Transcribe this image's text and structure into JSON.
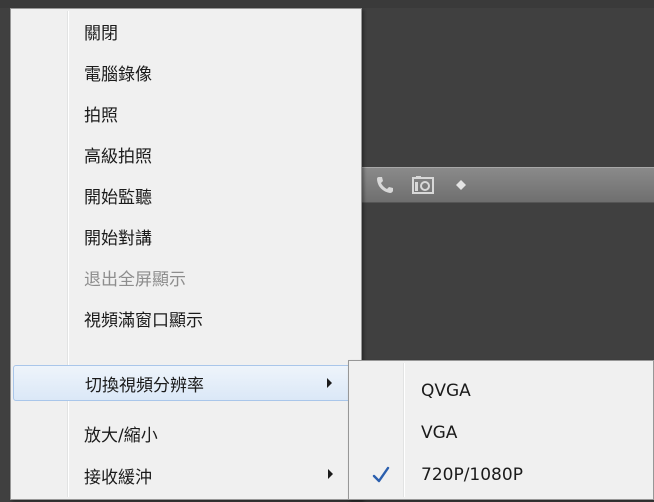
{
  "video": {
    "toolbar_icons": [
      "phone-icon",
      "camera-icon",
      "dot-icon"
    ]
  },
  "menu": {
    "items": [
      {
        "label": "關閉",
        "enabled": true
      },
      {
        "label": "電腦錄像",
        "enabled": true
      },
      {
        "label": "拍照",
        "enabled": true
      },
      {
        "label": "高級拍照",
        "enabled": true
      },
      {
        "label": "開始監聽",
        "enabled": true
      },
      {
        "label": "開始對講",
        "enabled": true
      },
      {
        "label": "退出全屏顯示",
        "enabled": false
      },
      {
        "label": "視頻滿窗口顯示",
        "enabled": true
      },
      {
        "label": "切換視頻分辨率",
        "enabled": true,
        "submenu": true,
        "highlighted": true
      },
      {
        "label": "放大/縮小",
        "enabled": true
      },
      {
        "label": "接收緩沖",
        "enabled": true,
        "submenu": true
      }
    ]
  },
  "submenu": {
    "items": [
      {
        "label": "QVGA",
        "checked": false
      },
      {
        "label": "VGA",
        "checked": false
      },
      {
        "label": "720P/1080P",
        "checked": true
      }
    ]
  },
  "colors": {
    "check": "#2b5fae",
    "highlight_border": "#a9c6ea"
  }
}
